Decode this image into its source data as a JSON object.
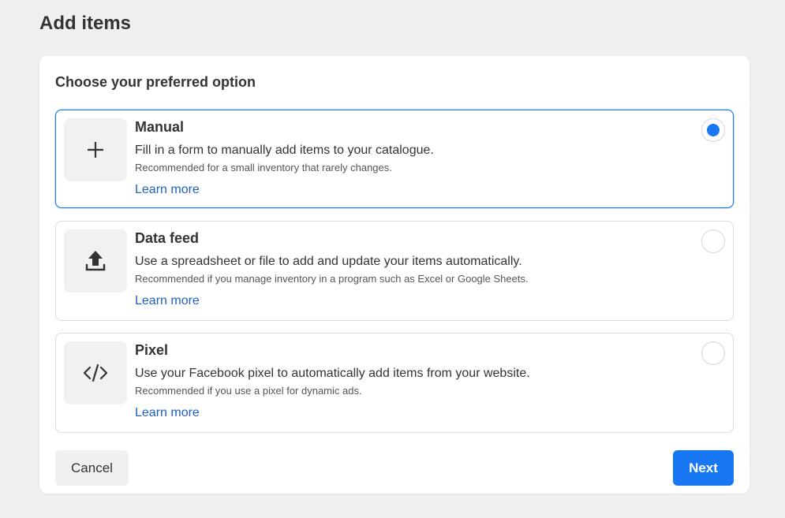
{
  "page": {
    "title": "Add items"
  },
  "card": {
    "heading": "Choose your preferred option",
    "options": [
      {
        "id": "manual",
        "icon": "plus-icon",
        "title": "Manual",
        "description": "Fill in a form to manually add items to your catalogue.",
        "recommendation": "Recommended for a small inventory that rarely changes.",
        "link_label": "Learn more",
        "selected": true
      },
      {
        "id": "data-feed",
        "icon": "upload-icon",
        "title": "Data feed",
        "description": "Use a spreadsheet or file to add and update your items automatically.",
        "recommendation": "Recommended if you manage inventory in a program such as Excel or Google Sheets.",
        "link_label": "Learn more",
        "selected": false
      },
      {
        "id": "pixel",
        "icon": "code-icon",
        "title": "Pixel",
        "description": "Use your Facebook pixel to automatically add items from your website.",
        "recommendation": "Recommended if you use a pixel for dynamic ads.",
        "link_label": "Learn more",
        "selected": false
      }
    ]
  },
  "footer": {
    "cancel_label": "Cancel",
    "next_label": "Next"
  },
  "colors": {
    "accent": "#1877f2",
    "link": "#1f5fc4",
    "background": "#f0f0f0"
  }
}
